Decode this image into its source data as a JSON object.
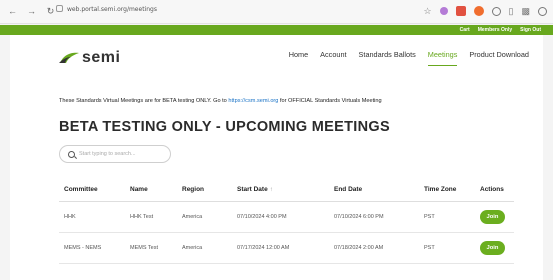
{
  "browser": {
    "url": "web.portal.semi.org/meetings"
  },
  "top_strip": {
    "links": [
      "Cart",
      "Members Only",
      "Sign Out"
    ]
  },
  "brand": {
    "logo_text": "semi",
    "accent_color": "#68a81e"
  },
  "menu": {
    "items": [
      "Home",
      "Account",
      "Standards Ballots",
      "Meetings",
      "Product Download"
    ],
    "active": "Meetings"
  },
  "notice": {
    "before": "These Standards Virtual Meetings are for BETA testing ONLY. Go to ",
    "link": "https://csm.semi.org",
    "after": " for OFFICIAL Standards Virtuals Meeting"
  },
  "heading": "BETA TESTING ONLY - UPCOMING MEETINGS",
  "search": {
    "placeholder": "Start typing to search..."
  },
  "table": {
    "columns": [
      "Committee",
      "Name",
      "Region",
      "Start Date",
      "End Date",
      "Time Zone",
      "Actions"
    ],
    "rows": [
      {
        "committee": "HHK",
        "name": "HHK Test",
        "region": "America",
        "start": "07/10/2024 4:00 PM",
        "end": "07/10/2024 6:00 PM",
        "tz": "PST",
        "action": "Join"
      },
      {
        "committee": "MEMS - NEMS",
        "name": "MEMS Test",
        "region": "America",
        "start": "07/17/2024 12:00 AM",
        "end": "07/18/2024 2:00 AM",
        "tz": "PST",
        "action": "Join"
      }
    ]
  }
}
